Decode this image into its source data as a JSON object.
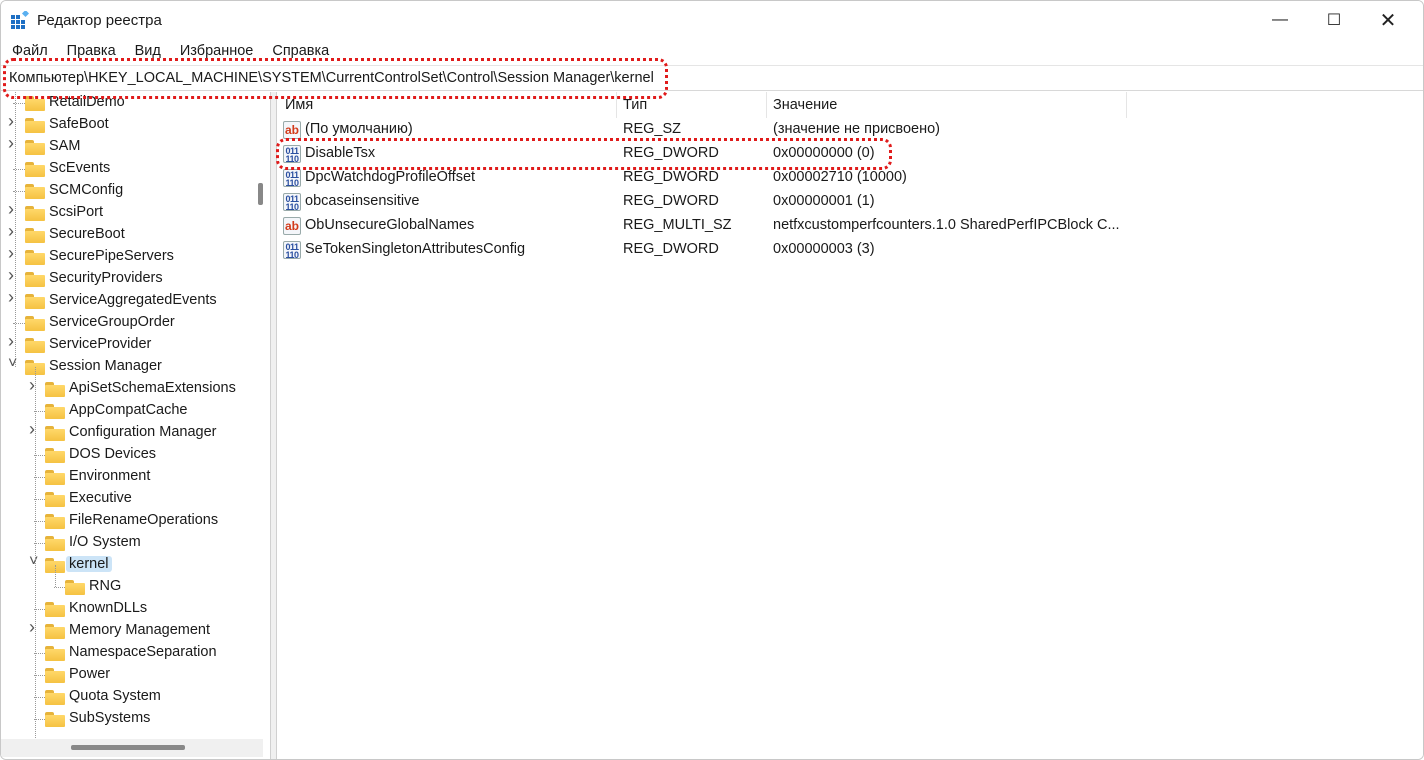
{
  "window": {
    "title": "Редактор реестра",
    "controls": [
      "minimize",
      "maximize",
      "close"
    ]
  },
  "menu": [
    "Файл",
    "Правка",
    "Вид",
    "Избранное",
    "Справка"
  ],
  "address": "Компьютер\\HKEY_LOCAL_MACHINE\\SYSTEM\\CurrentControlSet\\Control\\Session Manager\\kernel",
  "tree": [
    {
      "label": "RetailDemo",
      "level": 0,
      "exp": "none"
    },
    {
      "label": "SafeBoot",
      "level": 0,
      "exp": "collapsed"
    },
    {
      "label": "SAM",
      "level": 0,
      "exp": "collapsed"
    },
    {
      "label": "ScEvents",
      "level": 0,
      "exp": "none"
    },
    {
      "label": "SCMConfig",
      "level": 0,
      "exp": "none"
    },
    {
      "label": "ScsiPort",
      "level": 0,
      "exp": "collapsed"
    },
    {
      "label": "SecureBoot",
      "level": 0,
      "exp": "collapsed"
    },
    {
      "label": "SecurePipeServers",
      "level": 0,
      "exp": "collapsed"
    },
    {
      "label": "SecurityProviders",
      "level": 0,
      "exp": "collapsed"
    },
    {
      "label": "ServiceAggregatedEvents",
      "level": 0,
      "exp": "collapsed"
    },
    {
      "label": "ServiceGroupOrder",
      "level": 0,
      "exp": "none"
    },
    {
      "label": "ServiceProvider",
      "level": 0,
      "exp": "collapsed"
    },
    {
      "label": "Session Manager",
      "level": 0,
      "exp": "expanded"
    },
    {
      "label": "ApiSetSchemaExtensions",
      "level": 1,
      "exp": "collapsed"
    },
    {
      "label": "AppCompatCache",
      "level": 1,
      "exp": "none"
    },
    {
      "label": "Configuration Manager",
      "level": 1,
      "exp": "collapsed"
    },
    {
      "label": "DOS Devices",
      "level": 1,
      "exp": "none"
    },
    {
      "label": "Environment",
      "level": 1,
      "exp": "none"
    },
    {
      "label": "Executive",
      "level": 1,
      "exp": "none"
    },
    {
      "label": "FileRenameOperations",
      "level": 1,
      "exp": "none"
    },
    {
      "label": "I/O System",
      "level": 1,
      "exp": "none"
    },
    {
      "label": "kernel",
      "level": 1,
      "exp": "expanded",
      "selected": true
    },
    {
      "label": "RNG",
      "level": 2,
      "exp": "none"
    },
    {
      "label": "KnownDLLs",
      "level": 1,
      "exp": "none"
    },
    {
      "label": "Memory Management",
      "level": 1,
      "exp": "collapsed"
    },
    {
      "label": "NamespaceSeparation",
      "level": 1,
      "exp": "none"
    },
    {
      "label": "Power",
      "level": 1,
      "exp": "none"
    },
    {
      "label": "Quota System",
      "level": 1,
      "exp": "none"
    },
    {
      "label": "SubSystems",
      "level": 1,
      "exp": "none"
    }
  ],
  "columns": {
    "name": "Имя",
    "type": "Тип",
    "value": "Значение"
  },
  "values": [
    {
      "icon": "string-value-icon",
      "name": "(По умолчанию)",
      "type": "REG_SZ",
      "value": "(значение не присвоено)"
    },
    {
      "icon": "dword-value-icon",
      "name": "DisableTsx",
      "type": "REG_DWORD",
      "value": "0x00000000 (0)"
    },
    {
      "icon": "dword-value-icon",
      "name": "DpcWatchdogProfileOffset",
      "type": "REG_DWORD",
      "value": "0x00002710 (10000)"
    },
    {
      "icon": "dword-value-icon",
      "name": "obcaseinsensitive",
      "type": "REG_DWORD",
      "value": "0x00000001 (1)"
    },
    {
      "icon": "string-value-icon",
      "name": "ObUnsecureGlobalNames",
      "type": "REG_MULTI_SZ",
      "value": "netfxcustomperfcounters.1.0 SharedPerfIPCBlock C..."
    },
    {
      "icon": "dword-value-icon",
      "name": "SeTokenSingletonAttributesConfig",
      "type": "REG_DWORD",
      "value": "0x00000003 (3)"
    }
  ],
  "colors": {
    "annotation": "#e01b1b",
    "selection": "#cce4f7"
  }
}
